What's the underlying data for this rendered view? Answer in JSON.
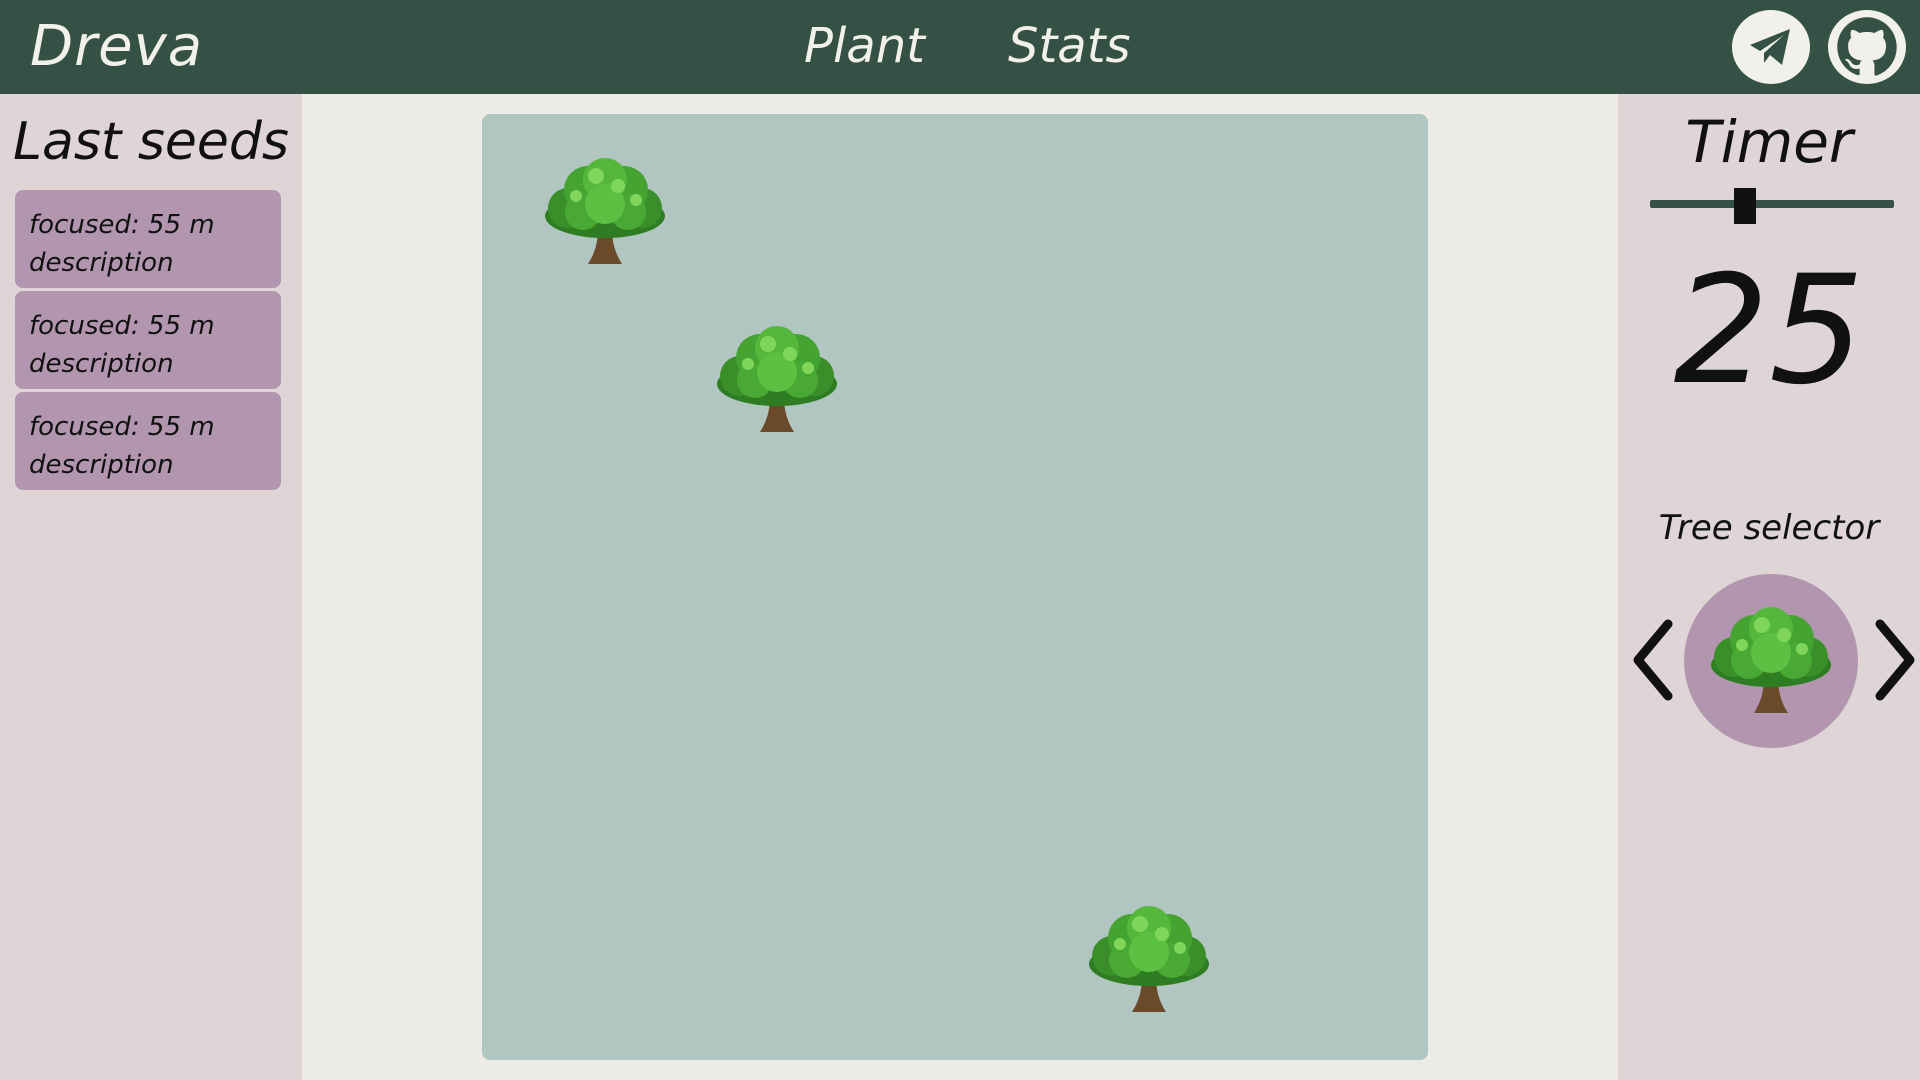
{
  "header": {
    "brand": "Dreva",
    "nav": [
      {
        "label": "Plant"
      },
      {
        "label": "Stats"
      }
    ],
    "icons": [
      "telegram-icon",
      "github-icon"
    ]
  },
  "last_seeds": {
    "title": "Last seeds",
    "items": [
      {
        "focused": "focused: 55 m",
        "description": "description"
      },
      {
        "focused": "focused: 55 m",
        "description": "description"
      },
      {
        "focused": "focused: 55 m",
        "description": "description"
      }
    ]
  },
  "garden": {
    "trees": [
      "tree-icon",
      "tree-icon",
      "tree-icon"
    ]
  },
  "timer": {
    "title": "Timer",
    "value": "25",
    "slider_fraction": 0.39
  },
  "tree_selector": {
    "label": "Tree selector",
    "selected": "tree-icon"
  },
  "colors": {
    "header": "#355145",
    "panel": "#dfd5d6",
    "card": "#b295ae",
    "garden": "#b2c6c1",
    "background": "#ecebe6"
  }
}
